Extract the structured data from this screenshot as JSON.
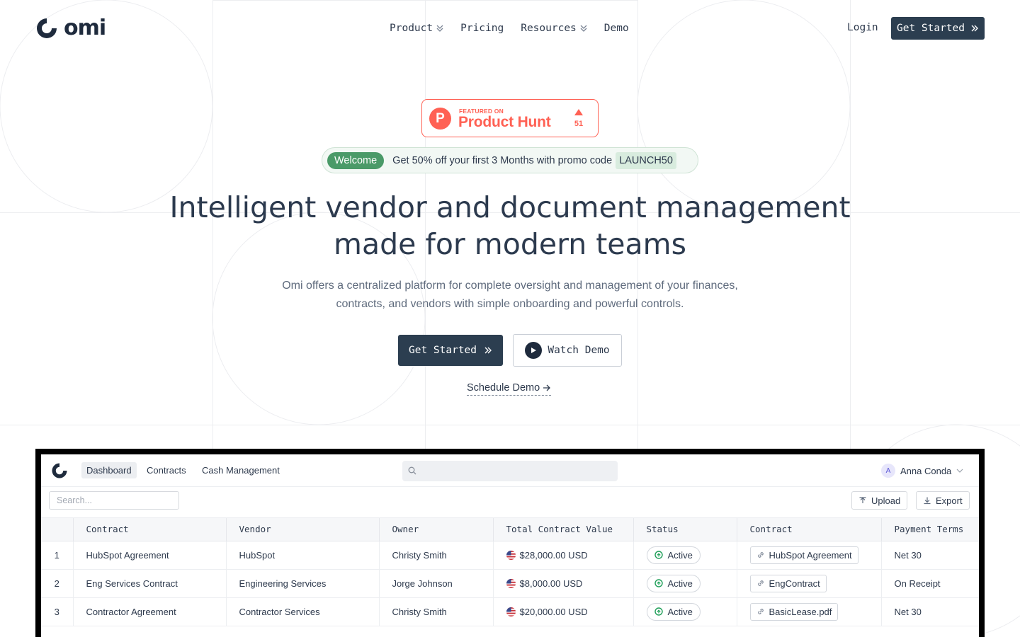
{
  "brand": {
    "name": "omi"
  },
  "nav": {
    "items": [
      {
        "label": "Product",
        "dropdown": true
      },
      {
        "label": "Pricing",
        "dropdown": false
      },
      {
        "label": "Resources",
        "dropdown": true
      },
      {
        "label": "Demo",
        "dropdown": false
      }
    ],
    "login": "Login",
    "get_started": "Get Started"
  },
  "product_hunt": {
    "small": "FEATURED ON",
    "big": "Product Hunt",
    "letter": "P",
    "count": "51"
  },
  "promo": {
    "tag": "Welcome",
    "text": "Get 50% off your first 3 Months with promo code",
    "code": "LAUNCH50"
  },
  "hero": {
    "title_line1": "Intelligent vendor and document management",
    "title_line2": "made for modern teams",
    "sub_line1": "Omi offers a centralized platform for complete oversight and management of your finances,",
    "sub_line2": "contracts, and vendors with simple onboarding and powerful controls.",
    "cta_primary": "Get Started",
    "cta_secondary": "Watch Demo",
    "schedule": "Schedule Demo"
  },
  "app": {
    "tabs": [
      "Dashboard",
      "Contracts",
      "Cash Management"
    ],
    "active_tab": "Dashboard",
    "user": {
      "initial": "A",
      "name": "Anna Conda"
    },
    "search_placeholder": "Search...",
    "upload": "Upload",
    "export": "Export",
    "columns": [
      "",
      "Contract",
      "Vendor",
      "Owner",
      "Total Contract Value",
      "Status",
      "Contract",
      "Payment Terms"
    ],
    "rows": [
      {
        "num": "1",
        "contract": "HubSpot Agreement",
        "vendor": "HubSpot",
        "owner": "Christy Smith",
        "value": "$28,000.00 USD",
        "status": "Active",
        "file": "HubSpot Agreement",
        "terms": "Net 30"
      },
      {
        "num": "2",
        "contract": "Eng Services Contract",
        "vendor": "Engineering Services",
        "owner": "Jorge Johnson",
        "value": "$8,000.00 USD",
        "status": "Active",
        "file": "EngContract",
        "terms": "On Receipt"
      },
      {
        "num": "3",
        "contract": "Contractor Agreement",
        "vendor": "Contractor Services",
        "owner": "Christy Smith",
        "value": "$20,000.00 USD",
        "status": "Active",
        "file": "BasicLease.pdf",
        "terms": "Net 30"
      }
    ]
  },
  "colors": {
    "primary": "#2c3e50",
    "product_hunt": "#ff6154",
    "promo_green": "#4a9a68",
    "status_green": "#22a05b"
  }
}
